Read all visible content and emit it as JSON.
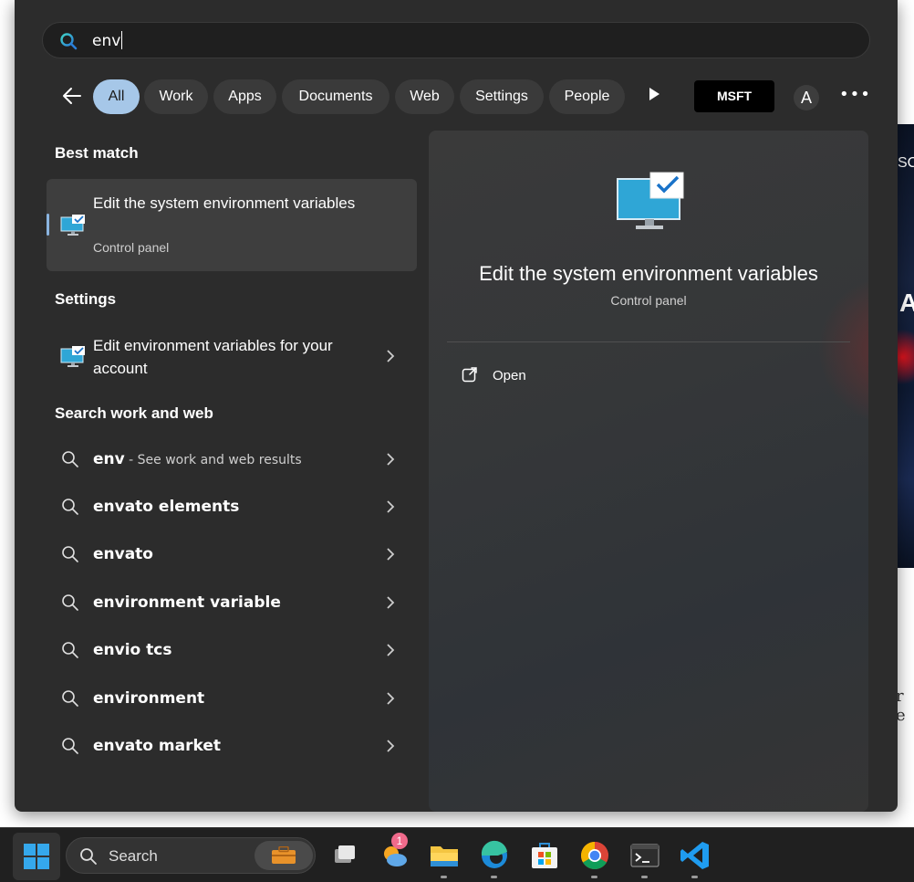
{
  "search": {
    "query": "env"
  },
  "filters": {
    "chips": [
      "All",
      "Work",
      "Apps",
      "Documents",
      "Web",
      "Settings",
      "People"
    ],
    "active": "All",
    "stock_label": "MSFT",
    "avatar_initial": "A"
  },
  "best_match": {
    "heading": "Best match",
    "title": "Edit the system environment variables",
    "subtitle": "Control panel",
    "icon": "control-panel-monitor-icon"
  },
  "settings_section": {
    "heading": "Settings",
    "item": "Edit environment variables for your account"
  },
  "web_section": {
    "heading": "Search work and web",
    "items": [
      {
        "text": "env",
        "sub": " - See work and web results"
      },
      {
        "text": "envato elements"
      },
      {
        "text": "envato"
      },
      {
        "text": "environment variable"
      },
      {
        "text": "envio tcs"
      },
      {
        "text": "environment"
      },
      {
        "text": "envato market"
      }
    ]
  },
  "preview": {
    "title": "Edit the system environment variables",
    "subtitle": "Control panel",
    "action_open": "Open"
  },
  "taskbar": {
    "search_label": "Search",
    "weather_badge": "1",
    "apps": [
      "start-icon",
      "task-view-icon",
      "weather-icon",
      "file-explorer-icon",
      "edge-icon",
      "store-icon",
      "chrome-icon",
      "terminal-icon",
      "vscode-icon"
    ]
  },
  "background": {
    "fragment_top": "SC",
    "fragment_mid": "A",
    "fragment_bottom": "r e"
  },
  "colors": {
    "panel": "#2c2c2c",
    "chip_active": "#a6c7e8",
    "accent": "#8ab4e0"
  }
}
